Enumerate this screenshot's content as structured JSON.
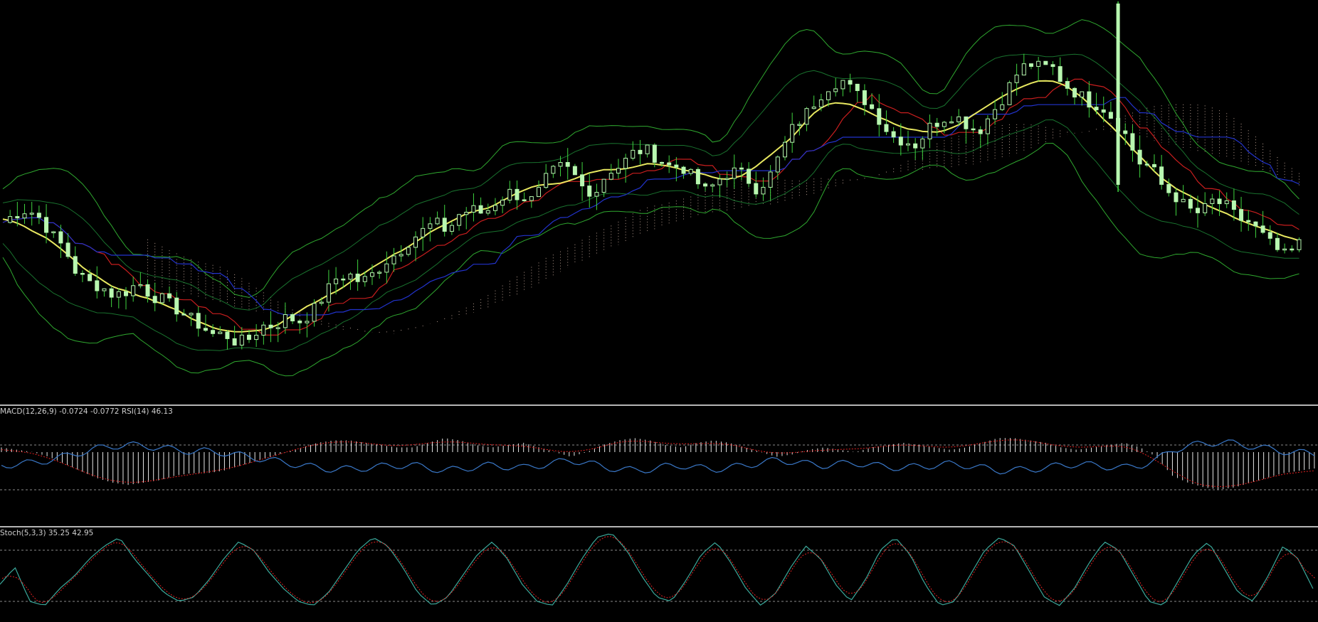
{
  "window": {
    "background": "#000000",
    "separator_color": "#b5b5b5"
  },
  "panes": {
    "main": {
      "name": "price-chart"
    },
    "macd": {
      "label": "MACD(12,26,9) -0.0724 -0.0772 RSI(14) 46.13"
    },
    "stoch": {
      "label": "Stoch(5,3,3) 35.25 42.95"
    }
  },
  "colors": {
    "candle": "#b8f7b0",
    "bollinger": "#2fa82f",
    "bollinger_inner": "#1f8f3a",
    "moving_average": "#e8e860",
    "tenkan": "#c81e1e",
    "kijun": "#2233cc",
    "cloud_dots": "#e0c0b0",
    "macd_hist": "#e8e8e8",
    "macd_signal": "#e02020",
    "rsi_line": "#3a78c8",
    "stoch_main": "#3aa89a",
    "stoch_signal": "#e02020",
    "level_line": "#8a8a8a"
  },
  "chart_data": [
    {
      "type": "line",
      "name": "main",
      "series": [
        {
          "name": "Close",
          "values": [
            50,
            52,
            53,
            51,
            47,
            44,
            38,
            36,
            35,
            33,
            34,
            36,
            33,
            32,
            30,
            28,
            26,
            24,
            24,
            22,
            23,
            26,
            26,
            28,
            27,
            29,
            33,
            37,
            38,
            36,
            38,
            41,
            43,
            46,
            48,
            50,
            48,
            52,
            53,
            52,
            55,
            57,
            56,
            55,
            60,
            63,
            62,
            58,
            57,
            62,
            63,
            66,
            67,
            65,
            63,
            63,
            60,
            57,
            60,
            62,
            61,
            58,
            60,
            66,
            72,
            75,
            79,
            82,
            83,
            80,
            78,
            74,
            70,
            69,
            68,
            72,
            74,
            75,
            73,
            71,
            75,
            79,
            84,
            87,
            86,
            86,
            82,
            80,
            78,
            77,
            74,
            70,
            64,
            63,
            58,
            56,
            53,
            52,
            55,
            54,
            51,
            50,
            47,
            44,
            42,
            45
          ]
        }
      ]
    },
    {
      "type": "bar",
      "name": "macd",
      "series": [
        {
          "name": "MACD",
          "values": [
            0.02,
            0.01,
            0.0,
            -0.02,
            -0.05,
            -0.08,
            -0.11,
            -0.13,
            -0.14,
            -0.13,
            -0.12,
            -0.1,
            -0.09,
            -0.09,
            -0.08,
            -0.06,
            -0.04,
            -0.02,
            0.0,
            0.02,
            0.04,
            0.05,
            0.05,
            0.04,
            0.03,
            0.02,
            0.02,
            0.04,
            0.06,
            0.05,
            0.03,
            0.02,
            0.03,
            0.04,
            0.02,
            0.0,
            -0.02,
            0.0,
            0.03,
            0.05,
            0.06,
            0.05,
            0.03,
            0.02,
            0.04,
            0.05,
            0.04,
            0.02,
            0.0,
            -0.02,
            -0.01,
            0.01,
            0.02,
            0.01,
            0.0,
            0.02,
            0.03,
            0.04,
            0.03,
            0.02,
            0.01,
            0.02,
            0.04,
            0.06,
            0.06,
            0.05,
            0.04,
            0.02,
            0.01,
            0.02,
            0.03,
            0.04,
            0.02,
            -0.02,
            -0.1,
            -0.13,
            -0.15,
            -0.16,
            -0.15,
            -0.13,
            -0.11,
            -0.09,
            -0.08,
            -0.07
          ]
        }
      ]
    },
    {
      "type": "line",
      "name": "stoch",
      "series": [
        {
          "name": "Main",
          "values": [
            40,
            60,
            20,
            15,
            35,
            50,
            70,
            85,
            95,
            70,
            50,
            30,
            20,
            25,
            45,
            70,
            90,
            80,
            55,
            35,
            20,
            15,
            30,
            55,
            80,
            95,
            85,
            60,
            30,
            15,
            25,
            50,
            75,
            90,
            70,
            40,
            20,
            15,
            40,
            70,
            95,
            100,
            80,
            50,
            25,
            20,
            45,
            75,
            90,
            65,
            35,
            15,
            30,
            60,
            85,
            70,
            40,
            20,
            45,
            80,
            95,
            75,
            40,
            15,
            20,
            50,
            80,
            95,
            85,
            55,
            25,
            15,
            35,
            65,
            90,
            80,
            50,
            20,
            15,
            45,
            75,
            90,
            60,
            30,
            20,
            50,
            85,
            70,
            35
          ]
        }
      ]
    }
  ]
}
